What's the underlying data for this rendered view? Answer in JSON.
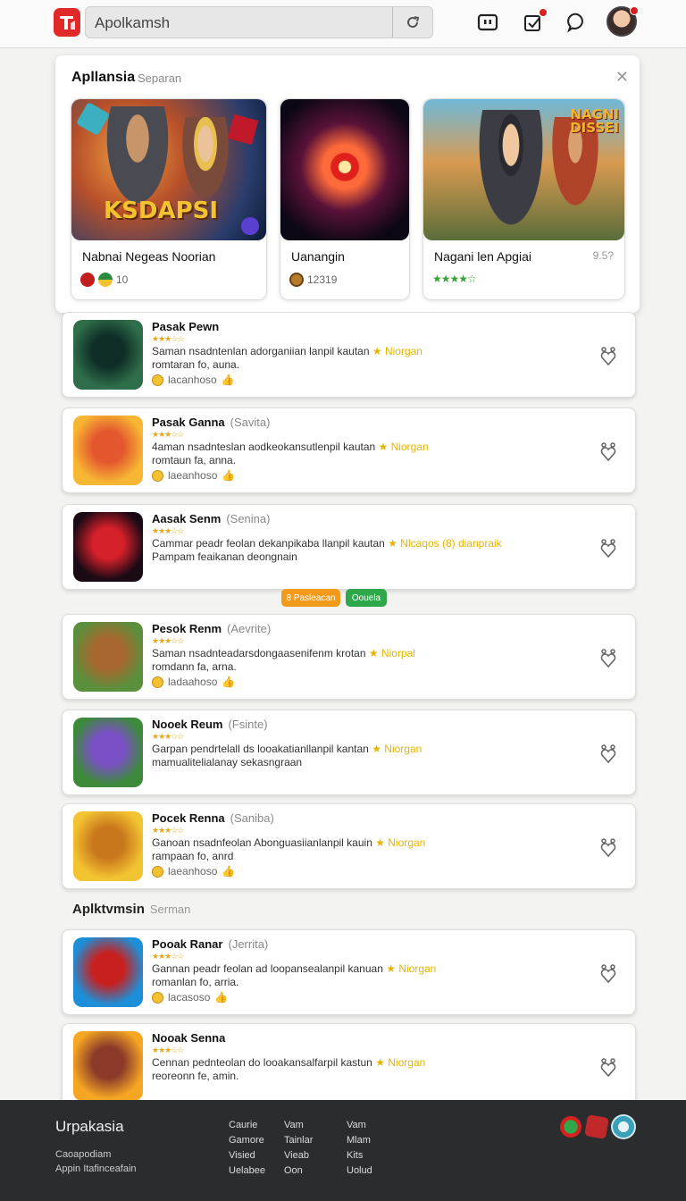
{
  "header": {
    "search_value": "Apolkamsh",
    "icons": [
      "app-logo-icon",
      "refresh-icon",
      "tv-icon",
      "notification-icon",
      "chat-icon"
    ]
  },
  "featured": {
    "title": "Apllansia",
    "subtitle": "Separan",
    "cards": [
      {
        "name": "Nabnai Negeas Noorian",
        "meta": "10",
        "extra": "",
        "art_label": "KSDAPSI"
      },
      {
        "name": "Uanangin",
        "meta": "12319",
        "extra": "",
        "art_label": ""
      },
      {
        "name": "Nagani len Apgiai",
        "meta": "",
        "extra": "9.5?",
        "art_label": "NAGNI DISSEI"
      }
    ]
  },
  "apps": [
    {
      "name": "Pasak Pewn",
      "sub": "",
      "desc1": "Saman nsadntenlan adorganiian lanpil kautan",
      "hl": "★ Niorgan",
      "desc2": "romtaran fo, auna.",
      "meta": "lacanhoso",
      "colors": [
        "#2f6e4a",
        "#0e2d26"
      ]
    },
    {
      "name": "Pasak Ganna",
      "sub": "(Savita)",
      "desc1": "4aman nsadnteslan aodkeokansutlenpil kautan",
      "hl": "★ Niorgan",
      "desc2": "romtaun fa, anna.",
      "meta": "laeanhoso",
      "colors": [
        "#f7b733",
        "#e4572e"
      ]
    },
    {
      "name": "Aasak Senm",
      "sub": "(Senina)",
      "desc1": "Cammar peadr feolan dekanpikaba llanpil kautan",
      "hl": "★ Nlcaqos (8) dianpraik",
      "desc2": "Pampam feaikanan deongnain",
      "meta": "",
      "colors": [
        "#1a0a14",
        "#d6202a"
      ]
    },
    {
      "name": "Pesok Renm",
      "sub": "(Aevrite)",
      "desc1": "Saman nsadnteadarsdongaasenifenm krotan",
      "hl": "★ Niorpal",
      "desc2": "romdann fa, arna.",
      "meta": "ladaahoso",
      "colors": [
        "#5a8f3c",
        "#a8672e"
      ]
    },
    {
      "name": "Nooek Reum",
      "sub": "(Fsinte)",
      "desc1": "Garpan pendrtelall ds looakatianllanpil kantan",
      "hl": "★ Niorgan",
      "desc2": "mamualitelialanay sekasngraan",
      "meta": "",
      "colors": [
        "#3c8a3a",
        "#7a4fc6"
      ]
    },
    {
      "name": "Pocek Renna",
      "sub": "(Saniba)",
      "desc1": "Ganoan nsadnfeolan Abonguasiianlanpil kauin",
      "hl": "★ Niorgan",
      "desc2": "rampaan fo, anrd",
      "meta": "laeanhoso",
      "colors": [
        "#f3c431",
        "#c9771c"
      ]
    }
  ],
  "pills": [
    "8 Pasleacan",
    "Oouela"
  ],
  "section": {
    "title": "Aplktvmsin",
    "subtitle": "Serman"
  },
  "apps2": [
    {
      "name": "Pooak Ranar",
      "sub": "(Jerrita)",
      "desc1": "Gannan peadr feolan ad loopansealanpil kanuan",
      "hl": "★ Niorgan",
      "desc2": "romanlan fo, arria.",
      "meta": "lacasoso",
      "colors": [
        "#1d8fd8",
        "#c8201e"
      ]
    },
    {
      "name": "Nooak Senna",
      "sub": "",
      "desc1": "Cennan pednteolan do looakansalfarpil kastun",
      "hl": "★ Niorgan",
      "desc2": "reoreonn fe, amin.",
      "meta": "",
      "colors": [
        "#f5a623",
        "#8b3a2a"
      ]
    }
  ],
  "footer": {
    "brand": "Urpakasia",
    "tag1": "Caoapodiam",
    "tag2": "Appin Itafinceafain",
    "col1": [
      "Caurie",
      "Gamore",
      "Visied",
      "Uelabee"
    ],
    "col2": [
      "Vam",
      "Tainlar",
      "Vieab",
      "Oon"
    ],
    "col3": [
      "Vam",
      "Mlam",
      "Kits",
      "Uolud"
    ]
  },
  "colors": {
    "brand": "#e02a2a",
    "star": "#f2b41c",
    "highlight": "#e6b400",
    "pill_orange": "#f29a1a",
    "pill_green": "#2ea84a",
    "footer_bg": "#2b2c2e"
  }
}
